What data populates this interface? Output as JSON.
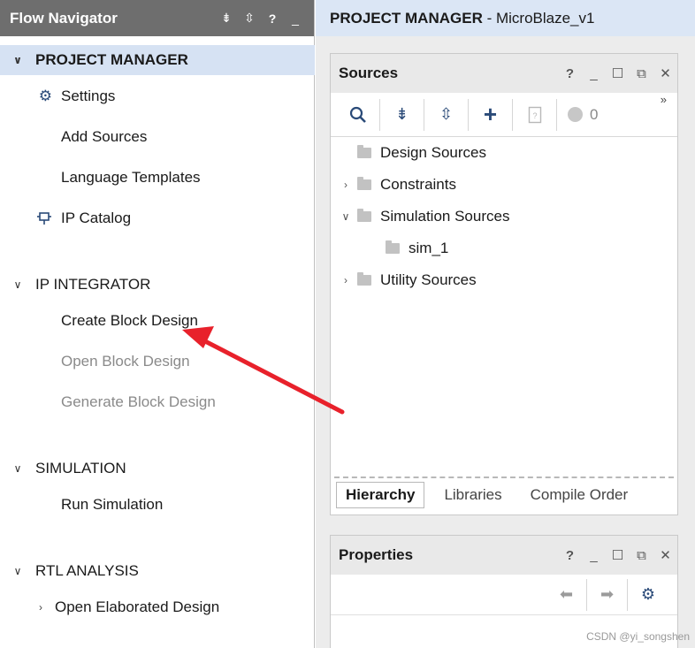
{
  "flow_navigator": {
    "title": "Flow Navigator",
    "header_icons": [
      "collapse-all-icon",
      "expand-all-icon",
      "help-icon",
      "minimize-icon"
    ],
    "sections": [
      {
        "label": "PROJECT MANAGER",
        "expanded": true,
        "items": [
          {
            "label": "Settings",
            "icon": "gear-icon",
            "enabled": true
          },
          {
            "label": "Add Sources",
            "icon": "",
            "enabled": true
          },
          {
            "label": "Language Templates",
            "icon": "",
            "enabled": true
          },
          {
            "label": "IP Catalog",
            "icon": "ip-catalog-icon",
            "enabled": true
          }
        ]
      },
      {
        "label": "IP INTEGRATOR",
        "expanded": true,
        "items": [
          {
            "label": "Create Block Design",
            "enabled": true
          },
          {
            "label": "Open Block Design",
            "enabled": false
          },
          {
            "label": "Generate Block Design",
            "enabled": false
          }
        ]
      },
      {
        "label": "SIMULATION",
        "expanded": true,
        "items": [
          {
            "label": "Run Simulation",
            "enabled": true
          }
        ]
      },
      {
        "label": "RTL ANALYSIS",
        "expanded": true,
        "items": [
          {
            "label": "Open Elaborated Design",
            "enabled": true
          }
        ]
      }
    ]
  },
  "main_header": {
    "title_bold": "PROJECT MANAGER",
    "title_rest": " - MicroBlaze_v1"
  },
  "sources": {
    "title": "Sources",
    "header_icons": [
      "help-icon",
      "minimize-icon",
      "maximize-icon",
      "float-icon",
      "close-icon"
    ],
    "toolbar": {
      "count": "0",
      "more": "»"
    },
    "tree": [
      {
        "label": "Design Sources",
        "expand": "none"
      },
      {
        "label": "Constraints",
        "expand": "collapsed"
      },
      {
        "label": "Simulation Sources",
        "expand": "expanded"
      },
      {
        "label": "sim_1",
        "expand": "none"
      },
      {
        "label": "Utility Sources",
        "expand": "collapsed"
      }
    ],
    "tabs": [
      "Hierarchy",
      "Libraries",
      "Compile Order"
    ],
    "active_tab": "Hierarchy"
  },
  "properties": {
    "title": "Properties",
    "header_icons": [
      "help-icon",
      "minimize-icon",
      "maximize-icon",
      "float-icon",
      "close-icon"
    ]
  },
  "watermark": "CSDN @yi_songshen",
  "colors": {
    "header_dark": "#6e6e6e",
    "active_row": "#d6e2f3",
    "icon_blue": "#2a4a78",
    "annotation_arrow": "#e8212b"
  }
}
